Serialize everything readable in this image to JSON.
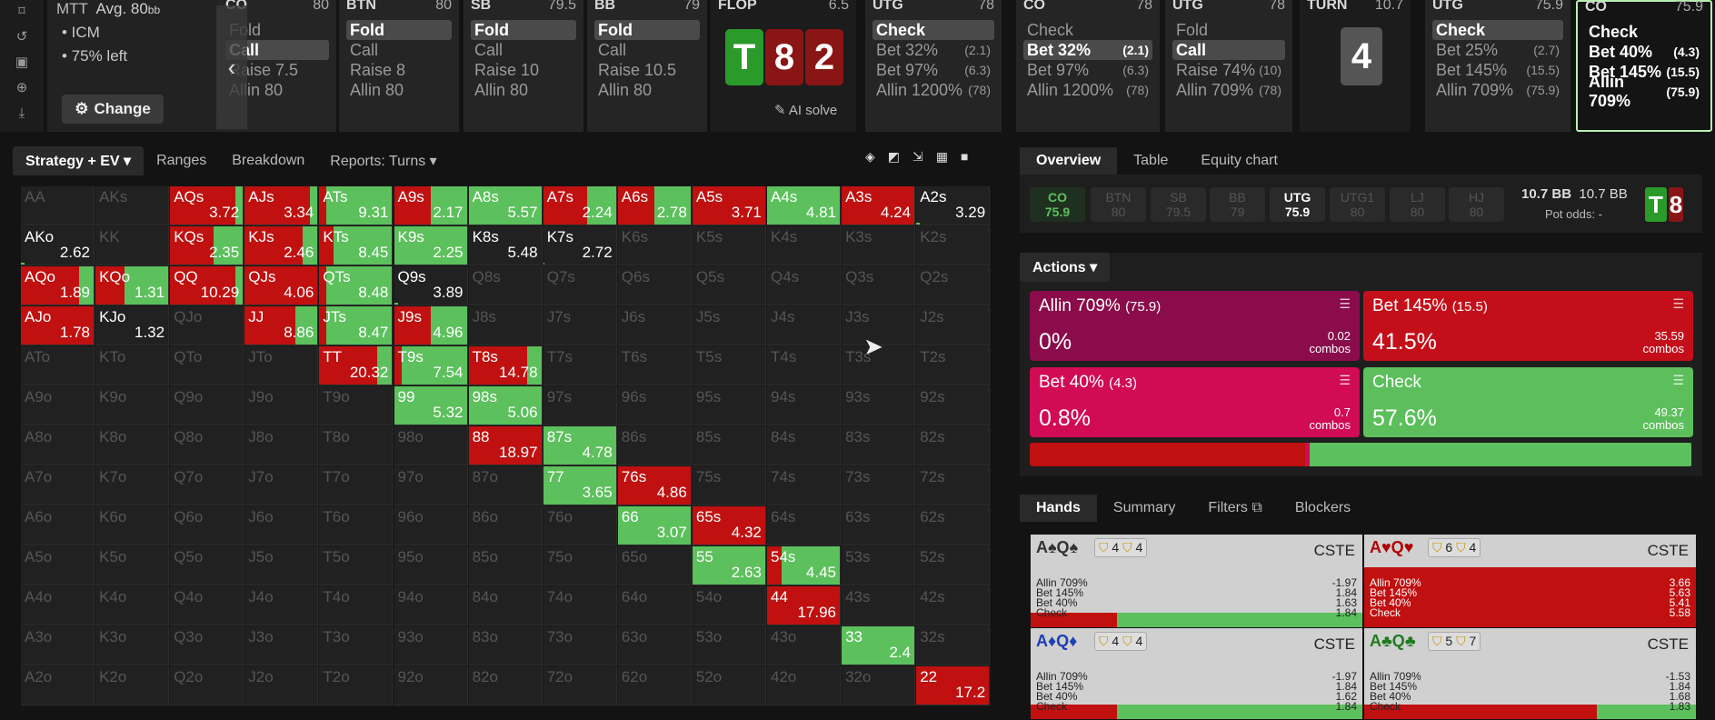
{
  "sidebar_icons": [
    "bookmark-icon",
    "history-icon",
    "save-icon",
    "gamepad-icon",
    "import-icon"
  ],
  "tournament": {
    "type": "MTT",
    "avg": "Avg. 80",
    "avg_unit": "bb",
    "bullets": [
      "• ICM",
      "• 75% left"
    ],
    "change_label": "Change"
  },
  "columns": [
    {
      "pos": "CO",
      "stack": "80",
      "items": [
        {
          "label": "Fold",
          "size": ""
        },
        {
          "label": "Call",
          "size": "",
          "sel": true
        },
        {
          "label": "Raise 7.5",
          "size": ""
        },
        {
          "label": "Allin 80",
          "size": ""
        }
      ]
    },
    {
      "pos": "BTN",
      "stack": "80",
      "items": [
        {
          "label": "Fold",
          "size": "",
          "sel": true
        },
        {
          "label": "Call",
          "size": ""
        },
        {
          "label": "Raise 8",
          "size": ""
        },
        {
          "label": "Allin 80",
          "size": ""
        }
      ]
    },
    {
      "pos": "SB",
      "stack": "79.5",
      "items": [
        {
          "label": "Fold",
          "size": "",
          "sel": true
        },
        {
          "label": "Call",
          "size": ""
        },
        {
          "label": "Raise 10",
          "size": ""
        },
        {
          "label": "Allin 80",
          "size": ""
        }
      ]
    },
    {
      "pos": "BB",
      "stack": "79",
      "items": [
        {
          "label": "Fold",
          "size": "",
          "sel": true
        },
        {
          "label": "Call",
          "size": ""
        },
        {
          "label": "Raise 10.5",
          "size": ""
        },
        {
          "label": "Allin 80",
          "size": ""
        }
      ]
    },
    {
      "pos": "UTG",
      "stack": "78",
      "items": [
        {
          "label": "Check",
          "size": "",
          "sel": true
        },
        {
          "label": "Bet 32%",
          "size": "(2.1)"
        },
        {
          "label": "Bet 97%",
          "size": "(6.3)"
        },
        {
          "label": "Allin 1200%",
          "size": "(78)"
        }
      ]
    },
    {
      "pos": "CO",
      "stack": "78",
      "items": [
        {
          "label": "Check",
          "size": ""
        },
        {
          "label": "Bet 32%",
          "size": "(2.1)",
          "sel": true
        },
        {
          "label": "Bet 97%",
          "size": "(6.3)"
        },
        {
          "label": "Allin 1200%",
          "size": "(78)"
        }
      ]
    },
    {
      "pos": "UTG",
      "stack": "78",
      "items": [
        {
          "label": "Fold",
          "size": ""
        },
        {
          "label": "Call",
          "size": "",
          "sel": true
        },
        {
          "label": "Raise 74%",
          "size": "(10)"
        },
        {
          "label": "Allin 709%",
          "size": "(78)"
        }
      ]
    },
    {
      "pos": "UTG",
      "stack": "75.9",
      "items": [
        {
          "label": "Check",
          "size": "",
          "sel": true
        },
        {
          "label": "Bet 25%",
          "size": "(2.7)"
        },
        {
          "label": "Bet 145%",
          "size": "(15.5)"
        },
        {
          "label": "Allin 709%",
          "size": "(75.9)"
        }
      ]
    },
    {
      "pos": "CO",
      "stack": "75.9",
      "items": [
        {
          "label": "Check",
          "size": ""
        },
        {
          "label": "Bet 40%",
          "size": "(4.3)"
        },
        {
          "label": "Bet 145%",
          "size": "(15.5)"
        },
        {
          "label": "Allin 709%",
          "size": "(75.9)"
        }
      ]
    }
  ],
  "flop": {
    "label": "FLOP",
    "pot": "6.5",
    "cards": [
      "T",
      "8",
      "2"
    ],
    "ai_solve": "AI solve"
  },
  "turn": {
    "label": "TURN",
    "pot": "10.7",
    "card": "4"
  },
  "grid_tabs": [
    "Strategy + EV",
    "Ranges",
    "Breakdown",
    "Reports: Turns"
  ],
  "view_icons": [
    "cube-icon",
    "half-square-icon",
    "compress-icon",
    "grid-icon",
    "square-icon"
  ],
  "grid_hands": [
    [
      "AA",
      "AKs",
      "AQs",
      "AJs",
      "ATs",
      "A9s",
      "A8s",
      "A7s",
      "A6s",
      "A5s",
      "A4s",
      "A3s",
      "A2s"
    ],
    [
      "AKo",
      "KK",
      "KQs",
      "KJs",
      "KTs",
      "K9s",
      "K8s",
      "K7s",
      "K6s",
      "K5s",
      "K4s",
      "K3s",
      "K2s"
    ],
    [
      "AQo",
      "KQo",
      "QQ",
      "QJs",
      "QTs",
      "Q9s",
      "Q8s",
      "Q7s",
      "Q6s",
      "Q5s",
      "Q4s",
      "Q3s",
      "Q2s"
    ],
    [
      "AJo",
      "KJo",
      "QJo",
      "JJ",
      "JTs",
      "J9s",
      "J8s",
      "J7s",
      "J6s",
      "J5s",
      "J4s",
      "J3s",
      "J2s"
    ],
    [
      "ATo",
      "KTo",
      "QTo",
      "JTo",
      "TT",
      "T9s",
      "T8s",
      "T7s",
      "T6s",
      "T5s",
      "T4s",
      "T3s",
      "T2s"
    ],
    [
      "A9o",
      "K9o",
      "Q9o",
      "J9o",
      "T9o",
      "99",
      "98s",
      "97s",
      "96s",
      "95s",
      "94s",
      "93s",
      "92s"
    ],
    [
      "A8o",
      "K8o",
      "Q8o",
      "J8o",
      "T8o",
      "98o",
      "88",
      "87s",
      "86s",
      "85s",
      "84s",
      "83s",
      "82s"
    ],
    [
      "A7o",
      "K7o",
      "Q7o",
      "J7o",
      "T7o",
      "97o",
      "87o",
      "77",
      "76s",
      "75s",
      "74s",
      "73s",
      "72s"
    ],
    [
      "A6o",
      "K6o",
      "Q6o",
      "J6o",
      "T6o",
      "96o",
      "86o",
      "76o",
      "66",
      "65s",
      "64s",
      "63s",
      "62s"
    ],
    [
      "A5o",
      "K5o",
      "Q5o",
      "J5o",
      "T5o",
      "95o",
      "85o",
      "75o",
      "65o",
      "55",
      "54s",
      "53s",
      "52s"
    ],
    [
      "A4o",
      "K4o",
      "Q4o",
      "J4o",
      "T4o",
      "94o",
      "84o",
      "74o",
      "64o",
      "54o",
      "44",
      "43s",
      "42s"
    ],
    [
      "A3o",
      "K3o",
      "Q3o",
      "J3o",
      "T3o",
      "93o",
      "83o",
      "73o",
      "63o",
      "53o",
      "43o",
      "33",
      "32s"
    ],
    [
      "A2o",
      "K2o",
      "Q2o",
      "J2o",
      "T2o",
      "92o",
      "82o",
      "72o",
      "62o",
      "52o",
      "42o",
      "32o",
      "22"
    ]
  ],
  "grid_cells": {
    "AQs": {
      "ev": "3.72",
      "r": 0.9,
      "g": 0.1
    },
    "AJs": {
      "ev": "3.34",
      "r": 0.9,
      "g": 0.1
    },
    "ATs": {
      "ev": "9.31",
      "r": 0.1,
      "g": 0.9
    },
    "A9s": {
      "ev": "2.17",
      "r": 0.5,
      "g": 0.5
    },
    "A8s": {
      "ev": "5.57",
      "r": 0.0,
      "g": 1.0
    },
    "A7s": {
      "ev": "2.24",
      "r": 0.6,
      "g": 0.4
    },
    "A6s": {
      "ev": "2.78",
      "r": 0.5,
      "g": 0.5
    },
    "A5s": {
      "ev": "3.71",
      "r": 1.0,
      "g": 0.0
    },
    "A4s": {
      "ev": "4.81",
      "r": 0.0,
      "g": 1.0
    },
    "A3s": {
      "ev": "4.24",
      "r": 1.0,
      "g": 0.0
    },
    "A2s": {
      "ev": "3.29",
      "r": 0.0,
      "g": 0.05
    },
    "AKo": {
      "ev": "2.62",
      "r": 0,
      "g": 0.05
    },
    "KQs": {
      "ev": "2.35",
      "r": 0.6,
      "g": 0.4
    },
    "KJs": {
      "ev": "2.46",
      "r": 0.8,
      "g": 0.2
    },
    "KTs": {
      "ev": "8.45",
      "r": 0.2,
      "g": 0.8
    },
    "K9s": {
      "ev": "2.25",
      "r": 0.0,
      "g": 1.0
    },
    "K8s": {
      "ev": "5.48",
      "r": 0,
      "g": 0
    },
    "K7s": {
      "ev": "2.72",
      "r": 0,
      "g": 0.02
    },
    "AQo": {
      "ev": "1.89",
      "r": 0.8,
      "g": 0.2
    },
    "KQo": {
      "ev": "1.31",
      "r": 0.4,
      "g": 0.6
    },
    "QQ": {
      "ev": "10.29",
      "r": 0.9,
      "g": 0.1
    },
    "QJs": {
      "ev": "4.06",
      "r": 1.0,
      "g": 0.0
    },
    "QTs": {
      "ev": "8.48",
      "r": 0.1,
      "g": 0.9
    },
    "Q9s": {
      "ev": "3.89",
      "r": 0,
      "g": 0.05
    },
    "AJo": {
      "ev": "1.78",
      "r": 1.0,
      "g": 0.0
    },
    "KJo": {
      "ev": "1.32",
      "r": 0,
      "g": 0
    },
    "JJ": {
      "ev": "8.86",
      "r": 0.7,
      "g": 0.3
    },
    "JTs": {
      "ev": "8.47",
      "r": 0.1,
      "g": 0.9
    },
    "J9s": {
      "ev": "4.96",
      "r": 0.5,
      "g": 0.5
    },
    "TT": {
      "ev": "20.32",
      "r": 0.8,
      "g": 0.2
    },
    "T9s": {
      "ev": "7.54",
      "r": 0.1,
      "g": 0.9
    },
    "T8s": {
      "ev": "14.78",
      "r": 0.8,
      "g": 0.2
    },
    "99": {
      "ev": "5.32",
      "r": 0.0,
      "g": 1.0
    },
    "98s": {
      "ev": "5.06",
      "r": 0.0,
      "g": 1.0
    },
    "88": {
      "ev": "18.97",
      "r": 1.0,
      "g": 0.0
    },
    "87s": {
      "ev": "4.78",
      "r": 0.0,
      "g": 1.0
    },
    "77": {
      "ev": "3.65",
      "r": 0.0,
      "g": 1.0
    },
    "76s": {
      "ev": "4.86",
      "r": 1.0,
      "g": 0.0
    },
    "66": {
      "ev": "3.07",
      "r": 0.0,
      "g": 1.0
    },
    "65s": {
      "ev": "4.32",
      "r": 1.0,
      "g": 0.0
    },
    "55": {
      "ev": "2.63",
      "r": 0.0,
      "g": 1.0
    },
    "54s": {
      "ev": "4.45",
      "r": 0.2,
      "g": 0.8
    },
    "44": {
      "ev": "17.96",
      "r": 1.0,
      "g": 0.0
    },
    "33": {
      "ev": "2.4",
      "r": 0.0,
      "g": 1.0
    },
    "22": {
      "ev": "17.2",
      "r": 1.0,
      "g": 0.0
    }
  },
  "right_tabs": [
    "Overview",
    "Table",
    "Equity chart"
  ],
  "positions": [
    {
      "pos": "CO",
      "stack": "75.9",
      "state": "grn"
    },
    {
      "pos": "BTN",
      "stack": "80",
      "state": "off"
    },
    {
      "pos": "SB",
      "stack": "79.5",
      "state": "off"
    },
    {
      "pos": "BB",
      "stack": "79",
      "state": "off"
    },
    {
      "pos": "UTG",
      "stack": "75.9",
      "state": "on"
    },
    {
      "pos": "UTG1",
      "stack": "80",
      "state": "off"
    },
    {
      "pos": "LJ",
      "stack": "80",
      "state": "off"
    },
    {
      "pos": "HJ",
      "stack": "80",
      "state": "off"
    }
  ],
  "pot": {
    "a": "10.7 BB",
    "b": "10.7 BB",
    "odds_label": "Pot odds:",
    "odds_value": "-"
  },
  "actions_label": "Actions",
  "actions": [
    {
      "name": "Allin 709%",
      "size": "(75.9)",
      "pct": "0%",
      "combos": "0.02",
      "color": "#8a0c4a"
    },
    {
      "name": "Bet 145%",
      "size": "(15.5)",
      "pct": "41.5%",
      "combos": "35.59",
      "color": "#c40f1a"
    },
    {
      "name": "Bet 40%",
      "size": "(4.3)",
      "pct": "0.8%",
      "combos": "0.7",
      "color": "#d10b55"
    },
    {
      "name": "Check",
      "size": "",
      "pct": "57.6%",
      "combos": "49.37",
      "color": "#5cbf5c"
    }
  ],
  "combos_label": "combos",
  "freq": [
    {
      "v": 41.5,
      "c": "#c01010"
    },
    {
      "v": 0.8,
      "c": "#d10b55"
    },
    {
      "v": 57.6,
      "c": "#5cc05c"
    }
  ],
  "hand_tabs": [
    "Hands",
    "Summary",
    "Filters",
    "Blockers"
  ],
  "hands": [
    {
      "name": "A♠Q♠",
      "suitc": "#333",
      "b": "4",
      "b2": "4",
      "tag": "CSTE",
      "rows": [
        [
          "Allin 709%",
          "-1.97"
        ],
        [
          "Bet 145%",
          "1.84"
        ],
        [
          "Bet 40%",
          "1.63"
        ],
        [
          "Check",
          "1.84"
        ]
      ],
      "r": 0.26,
      "g": 0.74,
      "red": false
    },
    {
      "name": "A♥Q♥",
      "suitc": "#b10000",
      "b": "6",
      "b2": "4",
      "tag": "CSTE",
      "rows": [
        [
          "Allin 709%",
          "3.66"
        ],
        [
          "Bet 145%",
          "5.63"
        ],
        [
          "Bet 40%",
          "5.41"
        ],
        [
          "Check",
          "5.58"
        ]
      ],
      "r": 1.0,
      "g": 0.0,
      "red": true
    },
    {
      "name": "A♦Q♦",
      "suitc": "#1d3fb5",
      "b": "4",
      "b2": "4",
      "tag": "CSTE",
      "rows": [
        [
          "Allin 709%",
          "-1.97"
        ],
        [
          "Bet 145%",
          "1.84"
        ],
        [
          "Bet 40%",
          "1.62"
        ],
        [
          "Check",
          "1.84"
        ]
      ],
      "r": 0.26,
      "g": 0.74,
      "red": false
    },
    {
      "name": "A♣Q♣",
      "suitc": "#1f7a1f",
      "b": "5",
      "b2": "7",
      "tag": "CSTE",
      "rows": [
        [
          "Allin 709%",
          "-1.53"
        ],
        [
          "Bet 145%",
          "1.84"
        ],
        [
          "Bet 40%",
          "1.68"
        ],
        [
          "Check",
          "1.83"
        ]
      ],
      "r": 0.7,
      "g": 0.3,
      "red": false
    }
  ]
}
